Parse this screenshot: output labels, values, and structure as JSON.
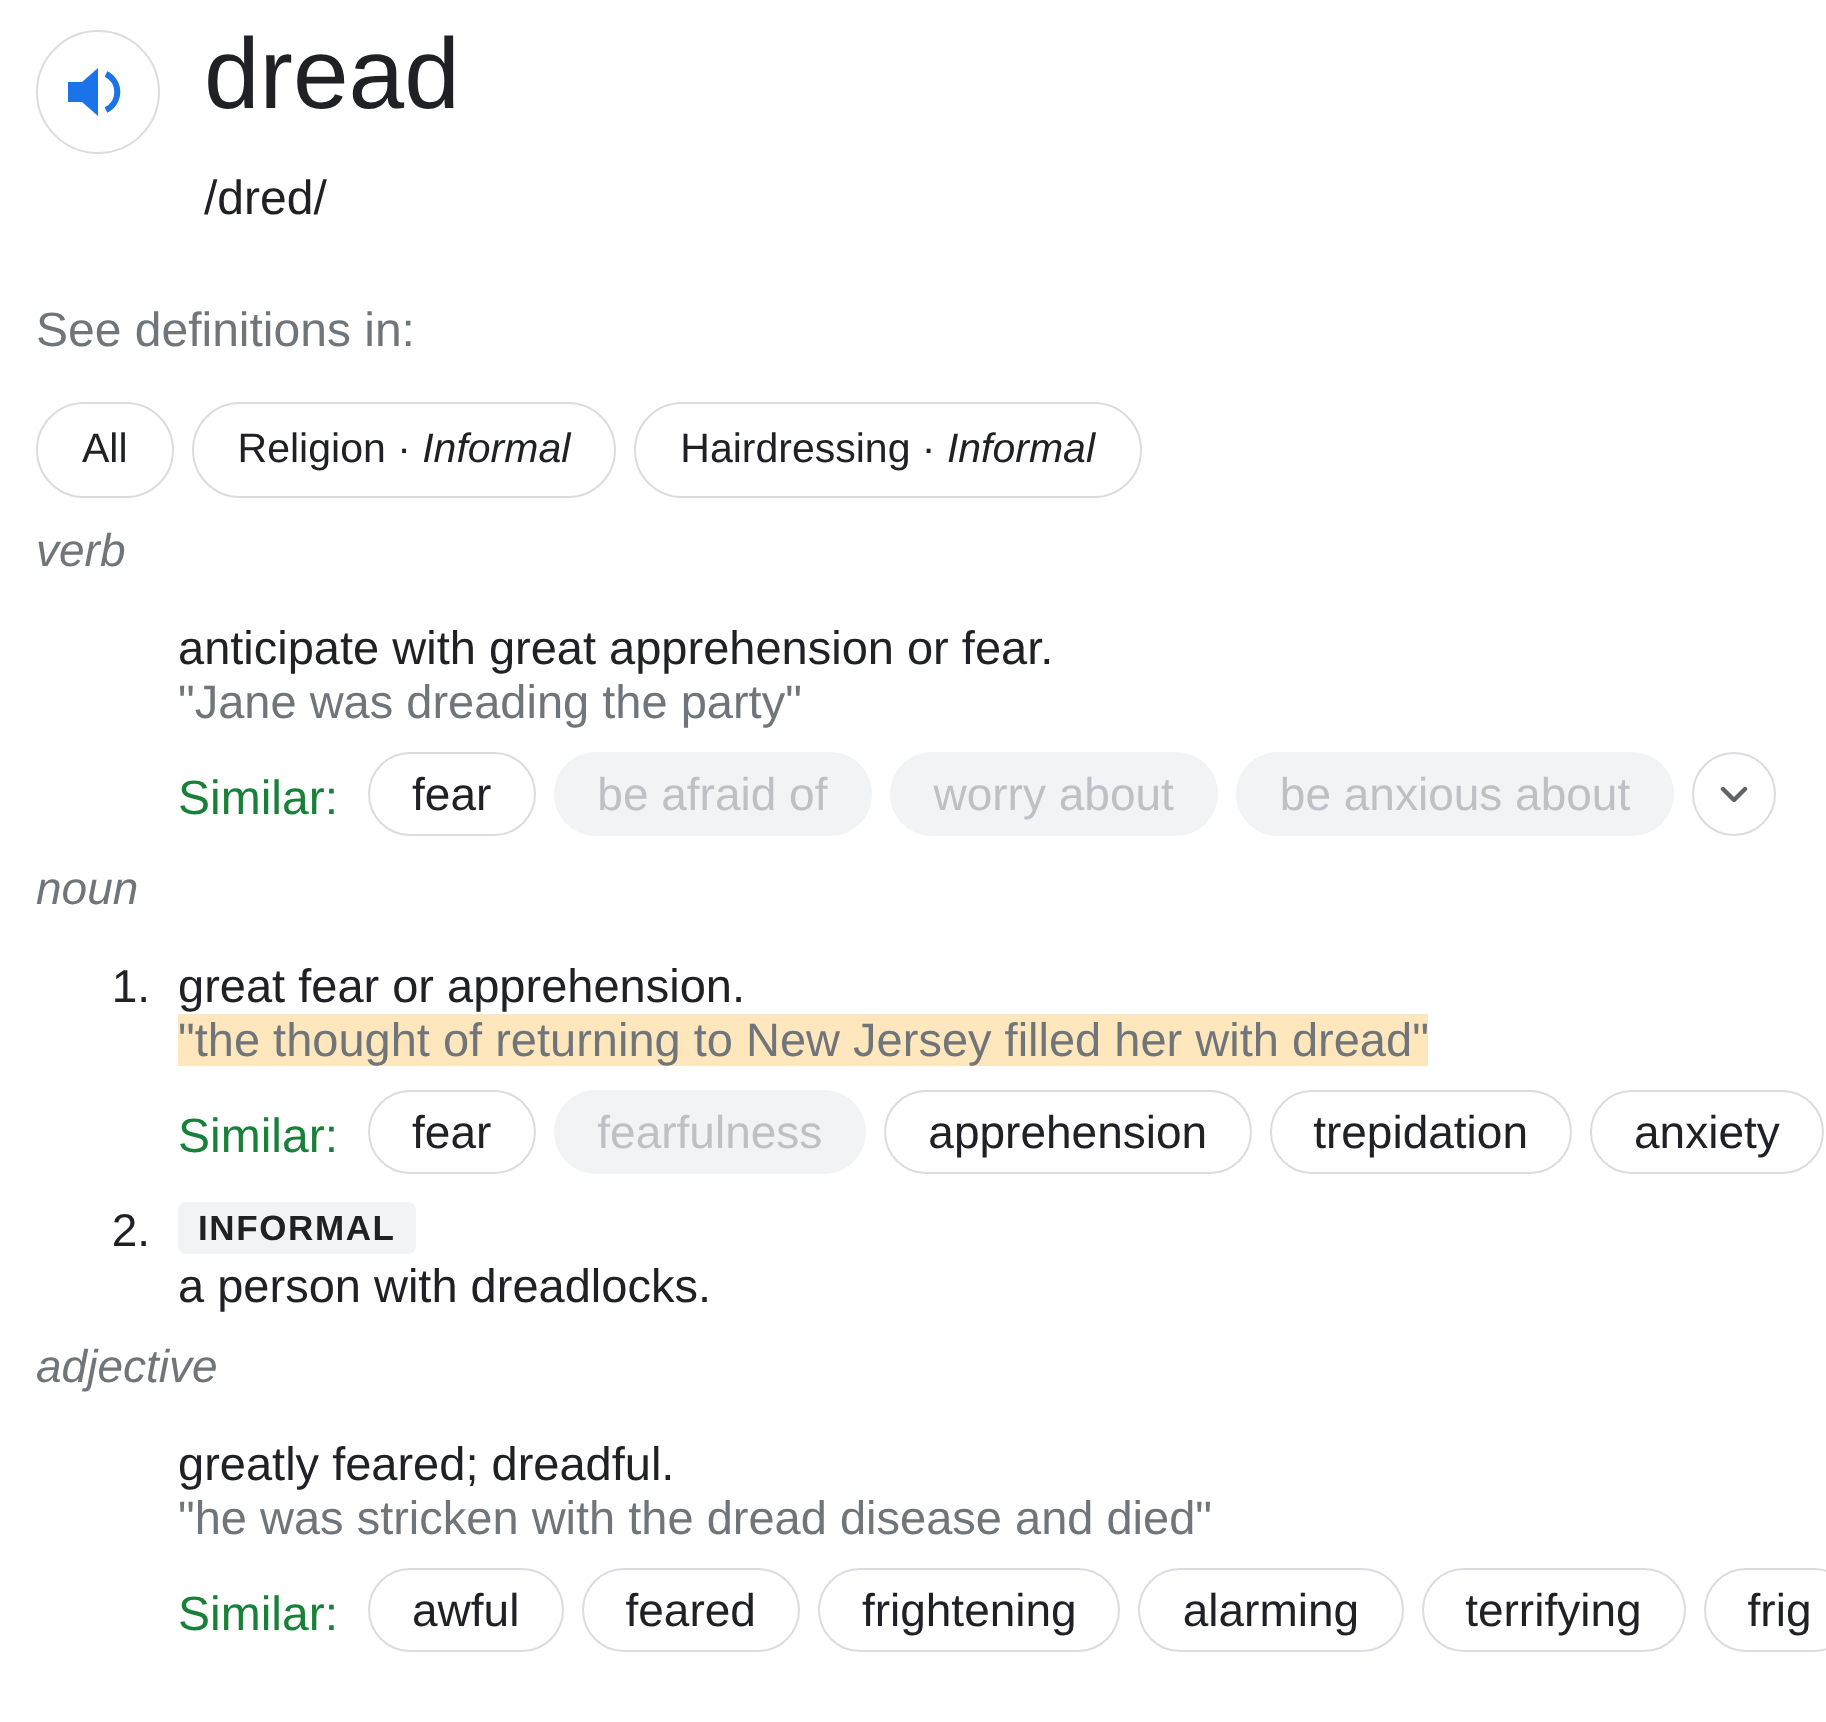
{
  "entry": {
    "word": "dread",
    "phonetic": "/dred/"
  },
  "sources": {
    "label": "See definitions in:",
    "chips": [
      {
        "text": "All"
      },
      {
        "text": "Religion · *Informal*"
      },
      {
        "text": "Hairdressing · *Informal*"
      }
    ]
  },
  "senses": [
    {
      "pos": "verb",
      "definitions": [
        {
          "text": "anticipate with great apprehension or fear.",
          "example": "\"Jane was dreading the party\"",
          "highlighted": false,
          "similar": {
            "label": "Similar:",
            "chips": [
              {
                "text": "fear",
                "disabled": false
              },
              {
                "text": "be afraid of",
                "disabled": true
              },
              {
                "text": "worry about",
                "disabled": true
              },
              {
                "text": "be anxious about",
                "disabled": true
              }
            ],
            "more_button": true
          }
        }
      ]
    },
    {
      "pos": "noun",
      "definitions": [
        {
          "number": "1.",
          "text": "great fear or apprehension.",
          "example": "\"the thought of returning to New Jersey filled her with dread\"",
          "highlighted": true,
          "similar": {
            "label": "Similar:",
            "chips": [
              {
                "text": "fear",
                "disabled": false
              },
              {
                "text": "fearfulness",
                "disabled": true
              },
              {
                "text": "apprehension",
                "disabled": false
              },
              {
                "text": "trepidation",
                "disabled": false
              },
              {
                "text": "anxiety",
                "disabled": false
              }
            ]
          }
        },
        {
          "number": "2.",
          "register": "INFORMAL",
          "text": "a person with dreadlocks."
        }
      ]
    },
    {
      "pos": "adjective",
      "definitions": [
        {
          "text": "greatly feared; dreadful.",
          "example": "\"he was stricken with the dread disease and died\"",
          "highlighted": false,
          "similar": {
            "label": "Similar:",
            "chips": [
              {
                "text": "awful",
                "disabled": false
              },
              {
                "text": "feared",
                "disabled": false
              },
              {
                "text": "frightening",
                "disabled": false
              },
              {
                "text": "alarming",
                "disabled": false
              },
              {
                "text": "terrifying",
                "disabled": false
              },
              {
                "text": "frig",
                "disabled": false
              }
            ]
          }
        }
      ]
    }
  ]
}
